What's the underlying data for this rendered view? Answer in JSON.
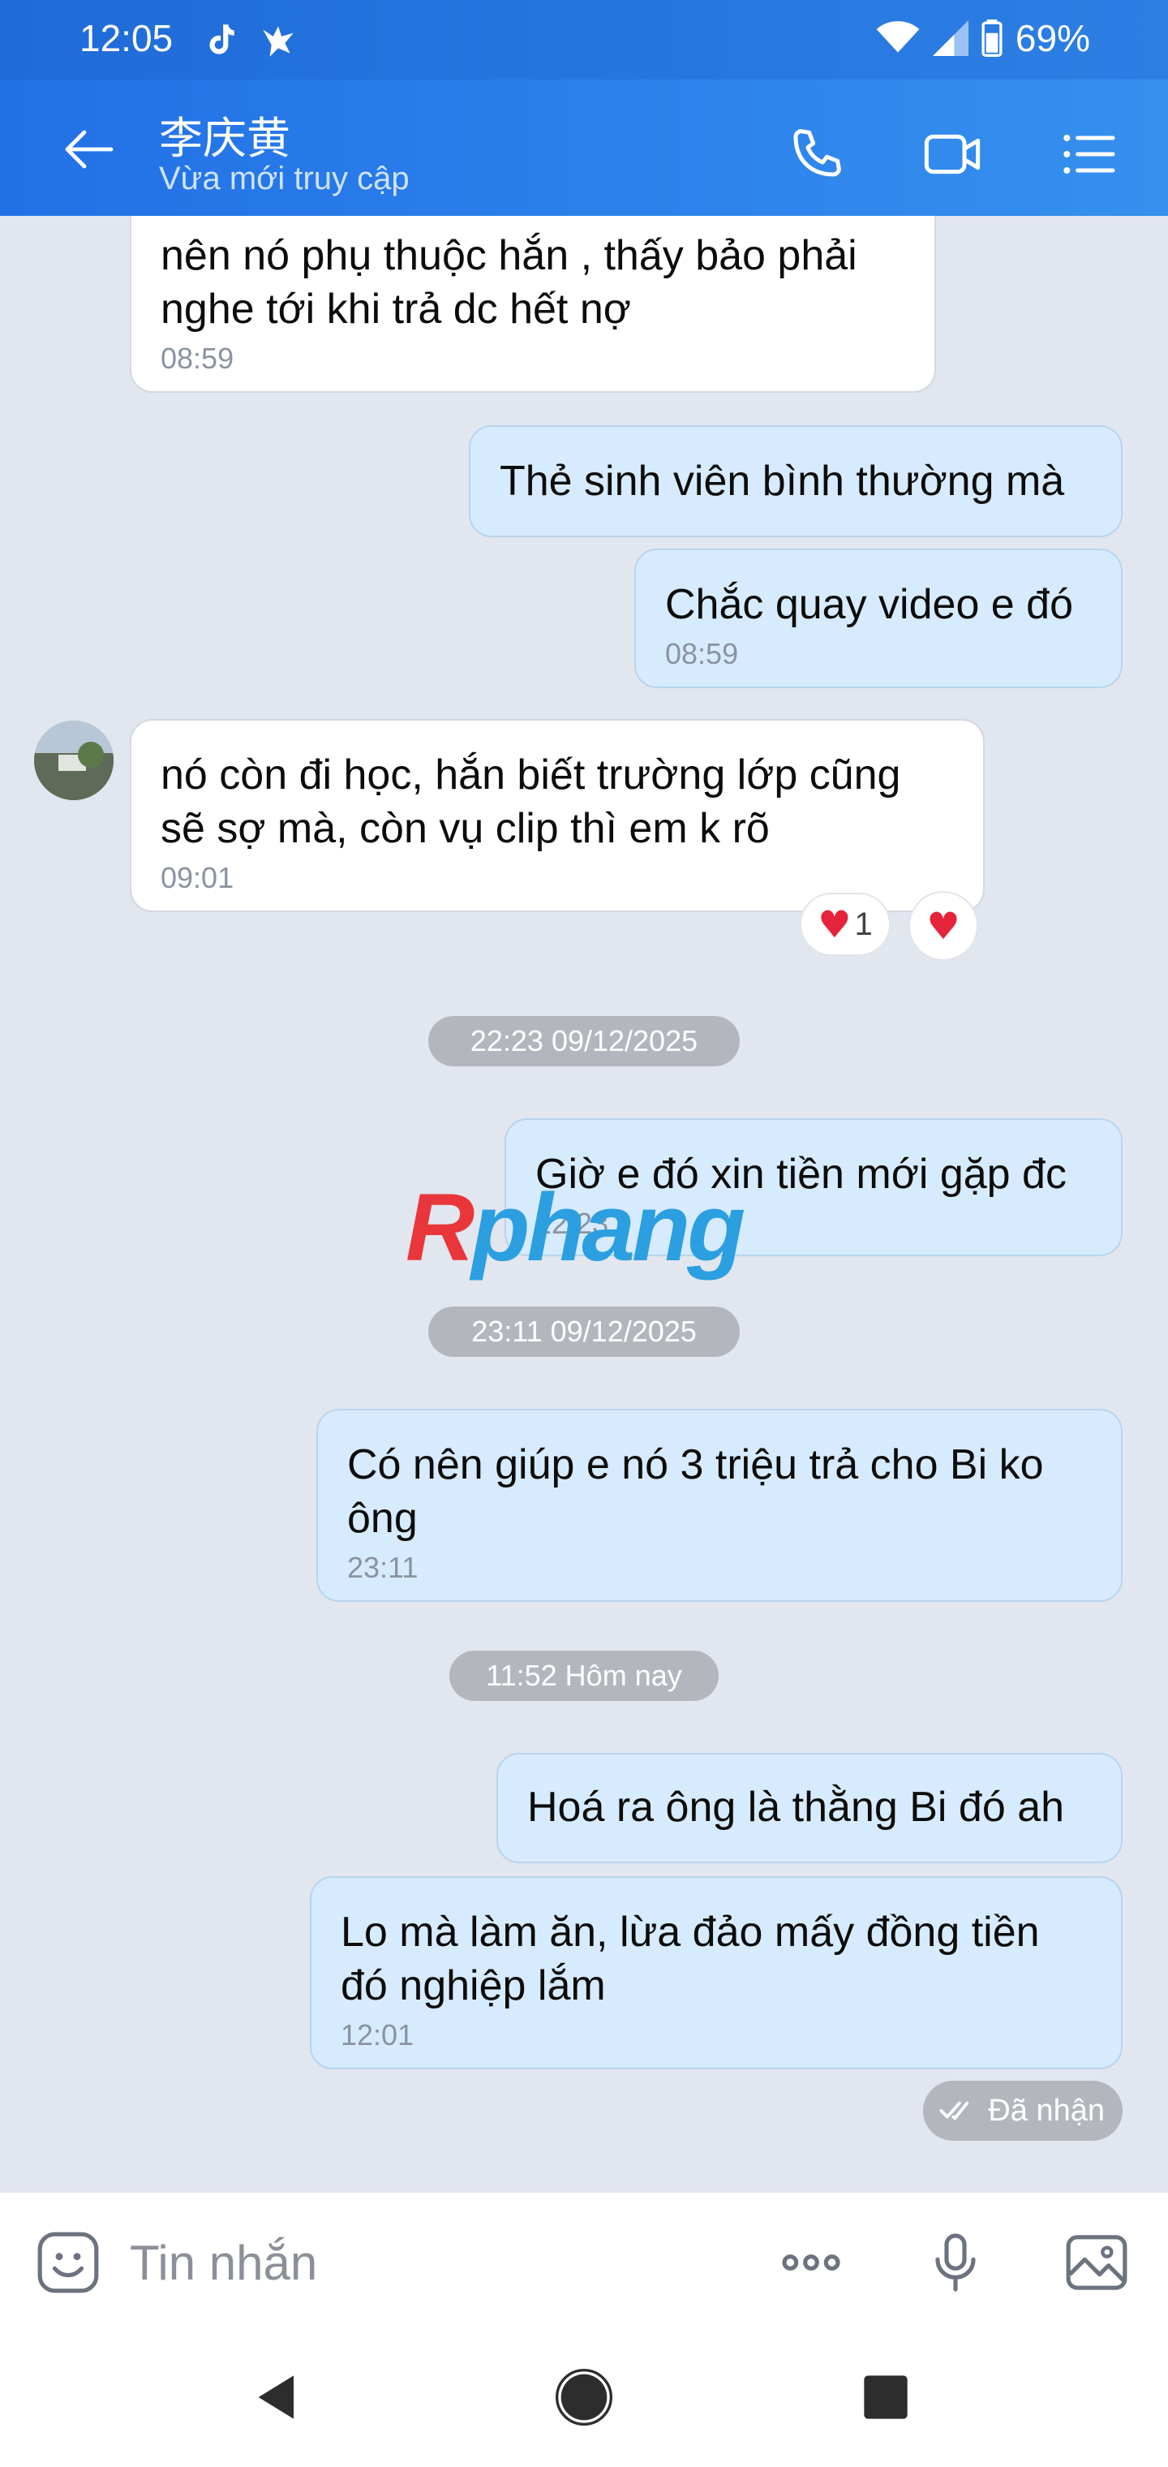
{
  "status_bar": {
    "time": "12:05",
    "battery": "69%"
  },
  "header": {
    "contact_name": "李庆黄",
    "subtitle": "Vừa mới truy cập"
  },
  "messages": [
    {
      "text": "nên nó phụ thuộc hắn , thấy bảo phải nghe tới khi trả dc hết nợ",
      "time": "08:59"
    },
    {
      "text": "Thẻ sinh viên bình thường mà"
    },
    {
      "text": "Chắc quay video e đó",
      "time": "08:59"
    },
    {
      "text": "nó còn đi học, hắn biết trường lớp cũng sẽ sợ mà, còn vụ clip thì em k rõ",
      "time": "09:01",
      "reaction_count": "1"
    },
    {
      "text": "Giờ e đó xin tiền mới gặp đc",
      "time": "22:23"
    },
    {
      "text": "Có nên giúp e nó 3 triệu trả cho Bi ko ông",
      "time": "23:11"
    },
    {
      "text": "Hoá ra ông là thằng Bi đó ah"
    },
    {
      "text": "Lo mà làm ăn, lừa đảo mấy đồng tiền đó nghiệp lắm",
      "time": "12:01"
    }
  ],
  "date_separators": [
    "22:23 09/12/2025",
    "23:11 09/12/2025",
    "11:52 Hôm nay"
  ],
  "delivery_status": "Đã nhận",
  "watermark": {
    "part1": "R",
    "part2": "phang"
  },
  "input": {
    "placeholder": "Tin nhắn"
  }
}
